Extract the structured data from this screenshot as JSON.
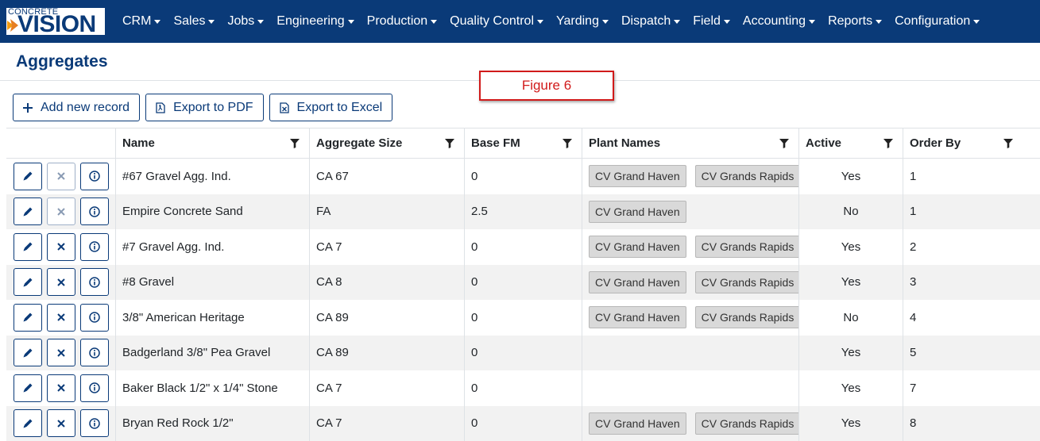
{
  "logo": {
    "small_text": "CONCRETE",
    "big_text": "VISION"
  },
  "nav": {
    "items": [
      {
        "label": "CRM"
      },
      {
        "label": "Sales"
      },
      {
        "label": "Jobs"
      },
      {
        "label": "Engineering"
      },
      {
        "label": "Production"
      },
      {
        "label": "Quality Control"
      },
      {
        "label": "Yarding"
      },
      {
        "label": "Dispatch"
      },
      {
        "label": "Field"
      },
      {
        "label": "Accounting"
      },
      {
        "label": "Reports"
      },
      {
        "label": "Configuration"
      }
    ]
  },
  "page": {
    "title": "Aggregates"
  },
  "annotation": {
    "label": "Figure 6",
    "color": "#d11a1a"
  },
  "toolbar": {
    "add_label": "Add new record",
    "pdf_label": "Export to PDF",
    "excel_label": "Export to Excel"
  },
  "colors": {
    "brand": "#0a3a78",
    "row_alt": "#f2f2f2",
    "tag_bg": "#d9d9d9"
  },
  "table": {
    "columns": [
      "Name",
      "Aggregate Size",
      "Base FM",
      "Plant Names",
      "Active",
      "Order By"
    ],
    "rows": [
      {
        "name": "#67 Gravel Agg. Ind.",
        "size": "CA 67",
        "fm": "0",
        "plants": [
          "CV Grand Haven",
          "CV Grands Rapids"
        ],
        "active": "Yes",
        "order": "1",
        "delete_disabled": true
      },
      {
        "name": "Empire Concrete Sand",
        "size": "FA",
        "fm": "2.5",
        "plants": [
          "CV Grand Haven"
        ],
        "active": "No",
        "order": "1",
        "delete_disabled": true
      },
      {
        "name": "#7 Gravel Agg. Ind.",
        "size": "CA 7",
        "fm": "0",
        "plants": [
          "CV Grand Haven",
          "CV Grands Rapids"
        ],
        "active": "Yes",
        "order": "2",
        "delete_disabled": false
      },
      {
        "name": "#8 Gravel",
        "size": "CA 8",
        "fm": "0",
        "plants": [
          "CV Grand Haven",
          "CV Grands Rapids"
        ],
        "active": "Yes",
        "order": "3",
        "delete_disabled": false
      },
      {
        "name": "3/8\" American Heritage",
        "size": "CA 89",
        "fm": "0",
        "plants": [
          "CV Grand Haven",
          "CV Grands Rapids"
        ],
        "active": "No",
        "order": "4",
        "delete_disabled": false
      },
      {
        "name": "Badgerland 3/8\" Pea Gravel",
        "size": "CA 89",
        "fm": "0",
        "plants": [],
        "active": "Yes",
        "order": "5",
        "delete_disabled": false
      },
      {
        "name": "Baker Black 1/2\" x 1/4\" Stone",
        "size": "CA 7",
        "fm": "0",
        "plants": [],
        "active": "Yes",
        "order": "7",
        "delete_disabled": false
      },
      {
        "name": "Bryan Red Rock 1/2\"",
        "size": "CA 7",
        "fm": "0",
        "plants": [
          "CV Grand Haven",
          "CV Grands Rapids"
        ],
        "active": "Yes",
        "order": "8",
        "delete_disabled": false
      }
    ]
  }
}
